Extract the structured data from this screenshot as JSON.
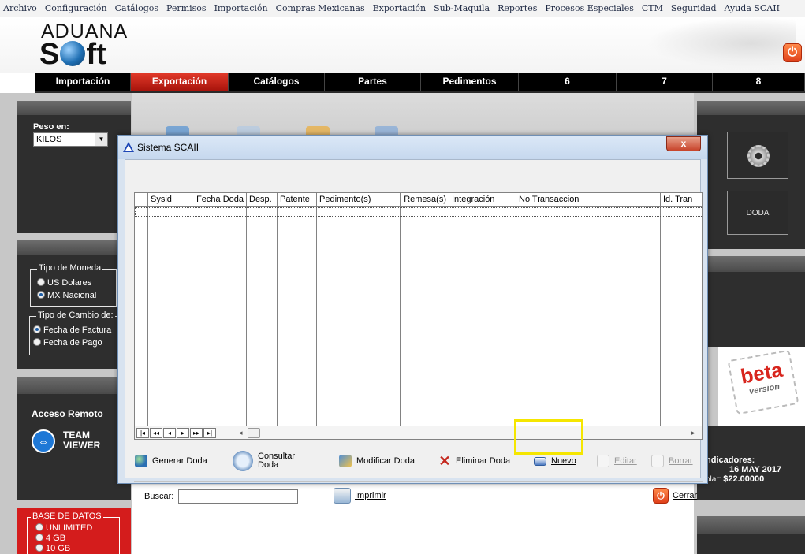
{
  "menu": [
    "Archivo",
    "Configuración",
    "Catálogos",
    "Permisos",
    "Importación",
    "Compras Mexicanas",
    "Exportación",
    "Sub-Maquila",
    "Reportes",
    "Procesos Especiales",
    "CTM",
    "Seguridad",
    "Ayuda SCAII"
  ],
  "logo": {
    "line1": "ADUANA",
    "line2_pre": "S",
    "line2_post": "ft"
  },
  "tabs": [
    {
      "label": "Importación",
      "active": false
    },
    {
      "label": "Exportación",
      "active": true
    },
    {
      "label": "Catálogos",
      "active": false
    },
    {
      "label": "Partes",
      "active": false
    },
    {
      "label": "Pedimentos",
      "active": false
    },
    {
      "label": "6",
      "active": false
    },
    {
      "label": "7",
      "active": false
    },
    {
      "label": "8",
      "active": false
    }
  ],
  "left": {
    "peso_label": "Peso en:",
    "peso_value": "KILOS",
    "moneda_legend": "Tipo de Moneda",
    "moneda_options": [
      "US Dolares",
      "MX Nacional"
    ],
    "moneda_selected": 1,
    "cambio_legend": "Tipo de Cambio de:",
    "cambio_options": [
      "Fecha de Factura",
      "Fecha de Pago"
    ],
    "cambio_selected": 0,
    "acceso": "Acceso Remoto",
    "tv_line1": "TEAM",
    "tv_line2": "VIEWER",
    "db_legend": "BASE DE DATOS",
    "db_options": [
      "UNLIMITED",
      "4 GB",
      "10 GB"
    ]
  },
  "right": {
    "doda_label": "DODA",
    "beta_line1": "beta",
    "beta_line2": "version",
    "ind_title": "ndicadores:",
    "ind_date": "16 MAY 2017",
    "ind_rate_label": "olar:",
    "ind_rate_value": "$22.00000"
  },
  "dialog": {
    "title": "Sistema SCAII",
    "close": "x",
    "columns": [
      "Sysid",
      "Fecha Doda",
      "Desp.",
      "Patente",
      "Pedimento(s)",
      "Remesa(s)",
      "Integración",
      "No Transaccion",
      "Id. Tran"
    ],
    "nav_buttons": [
      "|◂",
      "◂◂",
      "◂",
      "▸",
      "▸▸",
      "▸|"
    ],
    "toolbar": {
      "generar": "Generar Doda",
      "consultar_1": "Consultar",
      "consultar_2": "Doda",
      "modificar": "Modificar Doda",
      "eliminar": "Eliminar Doda",
      "nuevo": "Nuevo",
      "editar": "Editar",
      "borrar": "Borrar"
    },
    "search_label": "Buscar:",
    "search_value": "",
    "print_label": "Imprimir",
    "cerrar_label": "Cerrar"
  },
  "colors": {
    "accent_red": "#d41c1c",
    "highlight": "#f5e600",
    "title_blue": "#1d46b5"
  }
}
